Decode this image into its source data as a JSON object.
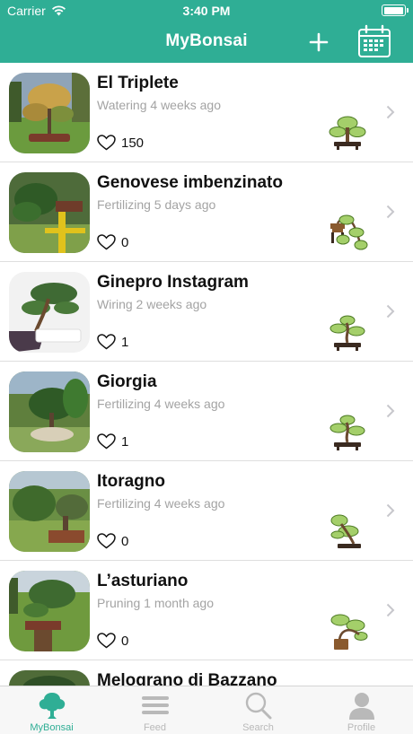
{
  "status_bar": {
    "carrier": "Carrier",
    "time": "3:40 PM",
    "battery_level": 1.0
  },
  "nav": {
    "title": "MyBonsai",
    "add_icon": "plus-icon",
    "calendar_icon": "calendar-icon"
  },
  "colors": {
    "accent": "#2fae95",
    "muted_text": "#a3a3a3",
    "tab_inactive": "#b9b9b9"
  },
  "bonsai_list": [
    {
      "name": "El Triplete",
      "activity": "Watering 4 weeks ago",
      "likes": "150",
      "style_icon": "upright-bonsai-icon"
    },
    {
      "name": "Genovese imbenzinato",
      "activity": "Fertilizing 5 days ago",
      "likes": "0",
      "style_icon": "cascade-bonsai-icon"
    },
    {
      "name": "Ginepro Instagram",
      "activity": "Wiring 2 weeks ago",
      "likes": "1",
      "style_icon": "informal-upright-bonsai-icon"
    },
    {
      "name": "Giorgia",
      "activity": "Fertilizing 4 weeks ago",
      "likes": "1",
      "style_icon": "informal-upright-bonsai-icon"
    },
    {
      "name": "Itoragno",
      "activity": "Fertilizing 4 weeks ago",
      "likes": "0",
      "style_icon": "slanting-bonsai-icon"
    },
    {
      "name": "L’asturiano",
      "activity": "Pruning 1 month ago",
      "likes": "0",
      "style_icon": "semi-cascade-bonsai-icon"
    },
    {
      "name": "Melograno di Bazzano",
      "activity": "",
      "likes": "",
      "style_icon": ""
    }
  ],
  "tabs": [
    {
      "label": "MyBonsai",
      "icon": "tree-icon",
      "active": true
    },
    {
      "label": "Feed",
      "icon": "feed-icon",
      "active": false
    },
    {
      "label": "Search",
      "icon": "search-icon",
      "active": false
    },
    {
      "label": "Profile",
      "icon": "profile-icon",
      "active": false
    }
  ]
}
